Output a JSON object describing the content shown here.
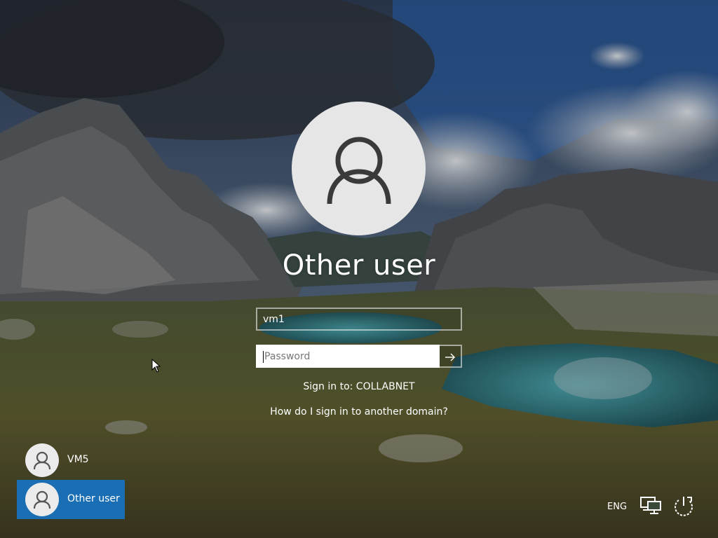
{
  "login": {
    "user_name": "Other user",
    "username_value": "vm1",
    "password_placeholder": "Password",
    "sign_in_to": "Sign in to: COLLABNET",
    "domain_help_link": "How do I sign in to another domain?"
  },
  "users": [
    {
      "label": "VM5",
      "selected": false
    },
    {
      "label": "Other user",
      "selected": true
    }
  ],
  "tray": {
    "language": "ENG",
    "network_icon": "network-icon",
    "power_icon": "power-icon"
  },
  "colors": {
    "selected_tile": "#1a6fb4",
    "avatar_bg": "#e6e6e6"
  }
}
